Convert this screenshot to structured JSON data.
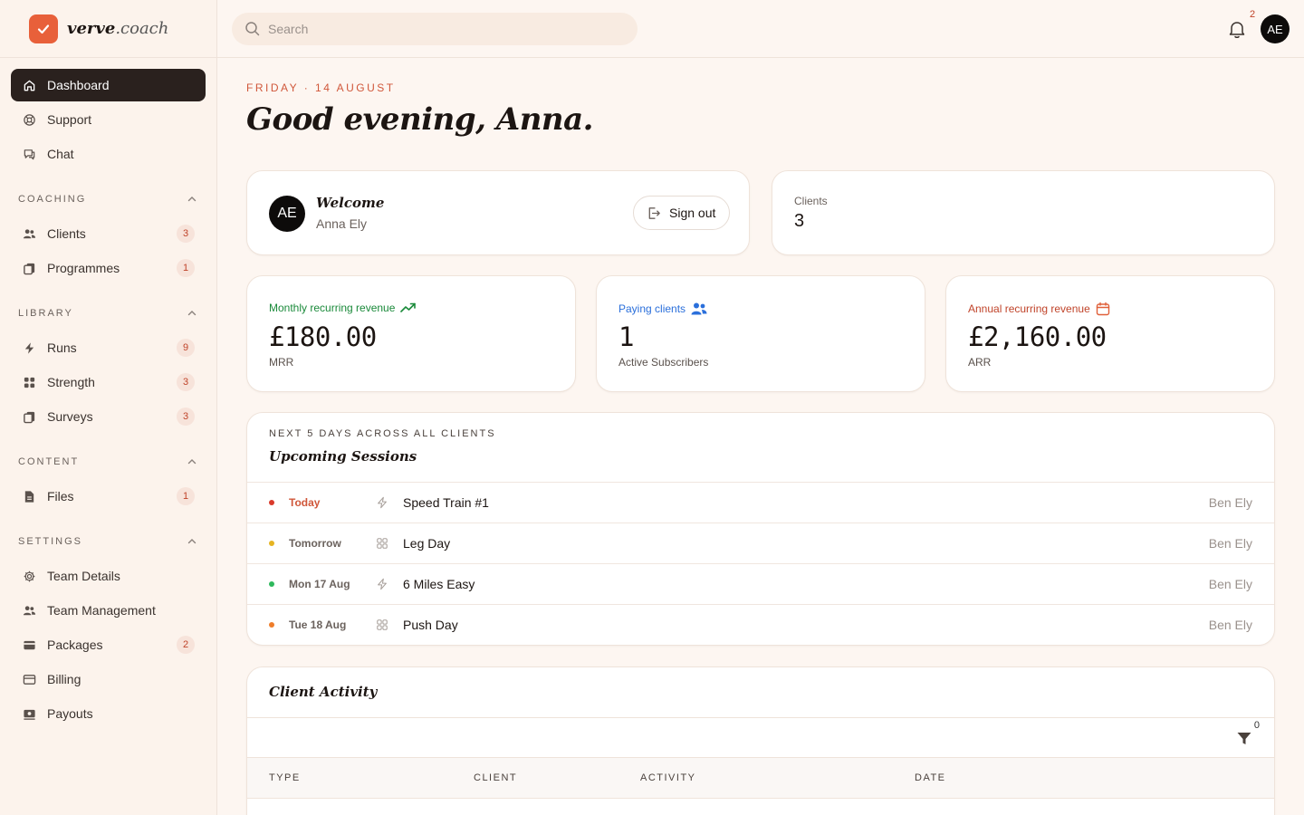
{
  "brand": {
    "name_bold": "verve",
    "name_rest": ".coach"
  },
  "search": {
    "placeholder": "Search"
  },
  "topbar": {
    "notifications_count": "2",
    "avatar_initials": "AE"
  },
  "sidebar": {
    "primary": [
      {
        "label": "Dashboard",
        "icon": "home-icon",
        "active": true
      },
      {
        "label": "Support",
        "icon": "lifebuoy-icon"
      },
      {
        "label": "Chat",
        "icon": "chat-icon"
      }
    ],
    "sections": [
      {
        "title": "COACHING",
        "items": [
          {
            "label": "Clients",
            "badge": "3",
            "icon": "users-icon"
          },
          {
            "label": "Programmes",
            "badge": "1",
            "icon": "clipboard-icon"
          }
        ]
      },
      {
        "title": "LIBRARY",
        "items": [
          {
            "label": "Runs",
            "badge": "9",
            "icon": "bolt-icon"
          },
          {
            "label": "Strength",
            "badge": "3",
            "icon": "grid-icon"
          },
          {
            "label": "Surveys",
            "badge": "3",
            "icon": "clipboard-icon"
          }
        ]
      },
      {
        "title": "CONTENT",
        "items": [
          {
            "label": "Files",
            "badge": "1",
            "icon": "file-icon"
          }
        ]
      },
      {
        "title": "SETTINGS",
        "items": [
          {
            "label": "Team Details",
            "badge": "",
            "icon": "gear-icon"
          },
          {
            "label": "Team Management",
            "badge": "",
            "icon": "users-icon"
          },
          {
            "label": "Packages",
            "badge": "2",
            "icon": "package-icon"
          },
          {
            "label": "Billing",
            "badge": "",
            "icon": "card-icon"
          },
          {
            "label": "Payouts",
            "badge": "",
            "icon": "payout-icon"
          }
        ]
      }
    ]
  },
  "main": {
    "date": "FRIDAY · 14 AUGUST",
    "greeting": "Good evening, Anna.",
    "welcome": {
      "title": "Welcome",
      "name": "Anna Ely",
      "initials": "AE",
      "signout_label": "Sign out"
    },
    "clients": {
      "label": "Clients",
      "value": "3"
    },
    "metrics": [
      {
        "label": "Monthly recurring revenue",
        "value": "£180.00",
        "sub": "MRR",
        "color": "#1a8a3a",
        "icon": "trending-up-icon"
      },
      {
        "label": "Paying clients",
        "value": "1",
        "sub": "Active Subscribers",
        "color": "#2a6fdb",
        "icon": "users-icon"
      },
      {
        "label": "Annual recurring revenue",
        "value": "£2,160.00",
        "sub": "ARR",
        "color": "#c0442a",
        "icon": "calendar-icon"
      }
    ],
    "sessions": {
      "kicker": "NEXT 5 DAYS ACROSS ALL CLIENTS",
      "title": "Upcoming Sessions",
      "rows": [
        {
          "day": "Today",
          "dot_color": "#d93a2b",
          "day_color": "#d0573a",
          "icon": "bolt-icon",
          "name": "Speed Train #1",
          "client": "Ben Ely"
        },
        {
          "day": "Tomorrow",
          "dot_color": "#e6b422",
          "day_color": "#6b625d",
          "icon": "grid-icon",
          "name": "Leg Day",
          "client": "Ben Ely"
        },
        {
          "day": "Mon 17 Aug",
          "dot_color": "#2eb85c",
          "day_color": "#6b625d",
          "icon": "bolt-icon",
          "name": "6 Miles Easy",
          "client": "Ben Ely"
        },
        {
          "day": "Tue 18 Aug",
          "dot_color": "#ef7d2a",
          "day_color": "#6b625d",
          "icon": "grid-icon",
          "name": "Push Day",
          "client": "Ben Ely"
        }
      ]
    },
    "activity": {
      "title": "Client Activity",
      "filter_count": "0",
      "columns": [
        "TYPE",
        "CLIENT",
        "ACTIVITY",
        "DATE"
      ]
    }
  }
}
